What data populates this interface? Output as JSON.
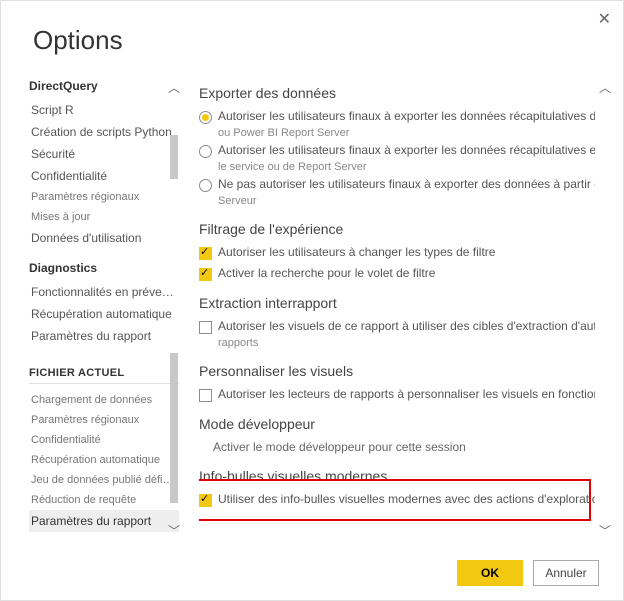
{
  "title": "Options",
  "sidebar": {
    "sections": [
      {
        "header": "DirectQuery",
        "caps": false,
        "bold": true
      },
      {
        "label": "Script R"
      },
      {
        "label": "Création de scripts Python"
      },
      {
        "label": "Sécurité"
      },
      {
        "label": "Confidentialité"
      },
      {
        "label": "Paramètres régionaux",
        "small": true
      },
      {
        "label": "Mises à jour",
        "small": true
      },
      {
        "label": "Données d'utilisation"
      },
      {
        "header": "Diagnostics",
        "bold": true
      },
      {
        "label": "Fonctionnalités en préversion"
      },
      {
        "label": "Récupération automatique"
      },
      {
        "label": "Paramètres du rapport"
      },
      {
        "header": "FICHIER ACTUEL",
        "caps": true
      },
      {
        "label": "Chargement de données",
        "small": true
      },
      {
        "label": "Paramètres régionaux",
        "small": true
      },
      {
        "label": "Confidentialité",
        "small": true
      },
      {
        "label": "Récupération automatique",
        "small": true
      },
      {
        "label": "Jeu de données publié défini…",
        "small": true
      },
      {
        "label": "Réduction de requête",
        "small": true
      },
      {
        "label": "Paramètres du rapport",
        "selected": true
      }
    ]
  },
  "content": {
    "export": {
      "title": "Exporter des données",
      "opt1": "Autoriser les utilisateurs finaux à exporter les données récapitulatives du se",
      "opt1_sub": "ou Power BI Report Server",
      "opt2": "Autoriser les utilisateurs finaux à exporter les données récapitulatives et sou",
      "opt2_sub": "le service ou de Report Server",
      "opt3": "Ne pas autoriser les utilisateurs finaux à exporter des données à partir du s",
      "opt3_sub": "Serveur"
    },
    "filter": {
      "title": "Filtrage de l'expérience",
      "opt1": "Autoriser les utilisateurs à changer les types de filtre",
      "opt2": "Activer la recherche pour le volet de filtre"
    },
    "crossreport": {
      "title": "Extraction interrapport",
      "opt1": "Autoriser les visuels de ce rapport à utiliser des cibles d'extraction d'autres",
      "opt1_sub": "rapports"
    },
    "personalize": {
      "title": "Personnaliser les visuels",
      "opt1": "Autoriser les lecteurs de rapports à personnaliser les visuels en fonction de"
    },
    "devmode": {
      "title": "Mode développeur",
      "text": "Activer le mode développeur pour cette session"
    },
    "tooltips": {
      "title": "Info-bulles visuelles modernes",
      "opt1": "Utiliser des info-bulles visuelles modernes avec des actions d'exploration e"
    }
  },
  "buttons": {
    "ok": "OK",
    "cancel": "Annuler"
  }
}
